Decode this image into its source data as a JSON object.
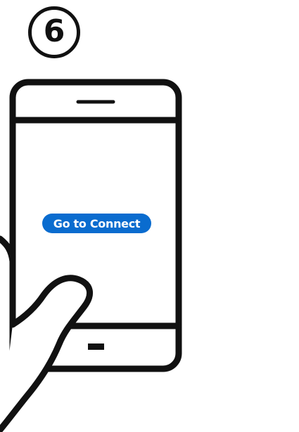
{
  "step": {
    "number": "6"
  },
  "phone": {
    "button_label": "Go to Connect",
    "button_color": "#0a6ccf",
    "outline_color": "#111111"
  },
  "icons": {
    "phone": "smartphone-outline",
    "hand": "hand-holding-phone"
  }
}
